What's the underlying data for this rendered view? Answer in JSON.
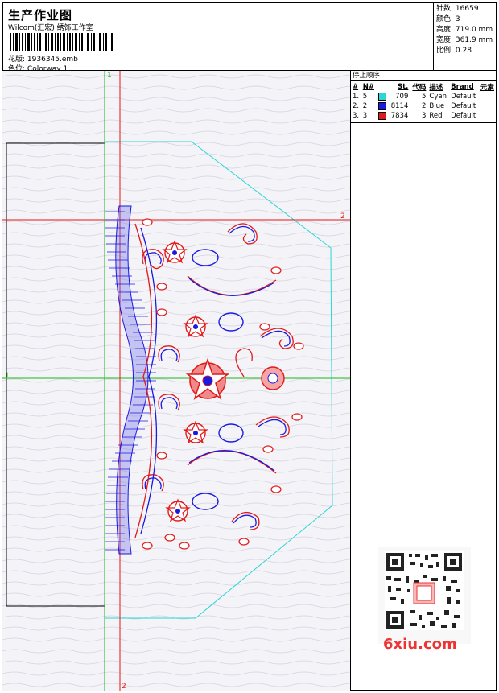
{
  "header": {
    "title": "生产作业图",
    "subtitle": "Wilcom(汇宏) 绣饰工作室",
    "file_label": "花版:",
    "file_value": "1936345.emb",
    "color_label": "色位:",
    "color_value": "Colorway 1"
  },
  "specs": [
    {
      "label": "针数:",
      "value": "16659"
    },
    {
      "label": "颜色:",
      "value": "3"
    },
    {
      "label": "高度:",
      "value": "719.0 mm"
    },
    {
      "label": "宽度:",
      "value": "361.9 mm"
    },
    {
      "label": "比例:",
      "value": "0.28"
    }
  ],
  "stop_sequence": {
    "title": "停止顺序:",
    "columns": [
      "#",
      "N#",
      "St.",
      "代码",
      "描述",
      "Brand",
      "元素"
    ],
    "rows": [
      {
        "idx": "1.",
        "n": "5",
        "st": "709",
        "code": "5",
        "desc": "Cyan",
        "brand": "Default",
        "color": "#2bd6d6"
      },
      {
        "idx": "2.",
        "n": "2",
        "st": "8114",
        "code": "2",
        "desc": "Blue",
        "brand": "Default",
        "color": "#1a1ae0"
      },
      {
        "idx": "3.",
        "n": "3",
        "st": "7834",
        "code": "3",
        "desc": "Red",
        "brand": "Default",
        "color": "#e01a1a"
      }
    ]
  },
  "guides": {
    "h_top_label": "2",
    "h_mid_label": "1",
    "v_top_label": "1",
    "v_bottom_label": "2"
  },
  "watermark": {
    "text": "6xiu.com"
  }
}
